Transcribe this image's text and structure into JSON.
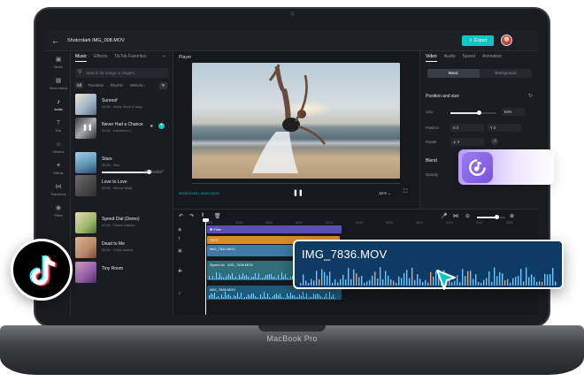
{
  "topbar": {
    "project_name": "Shotcrdark  IMG_008.MOV",
    "export_label": "Export"
  },
  "rail": {
    "items": [
      {
        "label": "Media",
        "icon": "media-icon"
      },
      {
        "label": "Stock videos",
        "icon": "stock-icon"
      },
      {
        "label": "Audio",
        "icon": "audio-icon",
        "active": true
      },
      {
        "label": "Text",
        "icon": "text-icon"
      },
      {
        "label": "Stickers",
        "icon": "stickers-icon"
      },
      {
        "label": "Effects",
        "icon": "effects-icon"
      },
      {
        "label": "Transitions",
        "icon": "transitions-icon"
      },
      {
        "label": "Filters",
        "icon": "filters-icon"
      }
    ]
  },
  "music": {
    "tabs": [
      "Music",
      "Effects",
      "TikTok Favorites"
    ],
    "search_placeholder": "Search for songs or singers",
    "filters": [
      "All",
      "Favorites",
      "Rhythm",
      "Melodic ‹"
    ],
    "tracks": [
      {
        "title": "Sunroof",
        "sub": "02:46 · Nicky Youre & dazy"
      },
      {
        "title": "Never Had a Chance",
        "sub": "01:45 · Katherine Li"
      },
      {
        "title": "Stars",
        "sub": "00:28 · Nico"
      },
      {
        "title": "Love to Love",
        "sub": "00:35 · Widow Waltz"
      },
      {
        "title": "Speed Dial (Demo)",
        "sub": "02:18 · Tanner Adams"
      },
      {
        "title": "Dead to Me",
        "sub": "02:24 · Chloe Adams"
      },
      {
        "title": "Tiny Room",
        "sub": ""
      }
    ],
    "progress_time": "00:38 / 02:27",
    "progress": 0.78
  },
  "player": {
    "label": "Player",
    "time": "00:00:00:15 / 00:00:23:00",
    "ratio": "16:9 ⌄"
  },
  "inspector": {
    "tabs": [
      "Video",
      "Audio",
      "Speed",
      "Animation"
    ],
    "segments": [
      "Basic",
      "Background"
    ],
    "position_title": "Position and size",
    "size_label": "Size",
    "size_value": "63%",
    "size_fraction": 0.63,
    "position_label": "Position",
    "pos_x": "X  2",
    "pos_y": "Y  2",
    "rotate_label": "Rotate",
    "rotate_value": "∠  2",
    "blend_title": "Blend",
    "opacity_label": "Opacity"
  },
  "timeline": {
    "ruler": [
      "00:00",
      "00:03",
      "00:06",
      "00:09",
      "00:12",
      "00:15",
      "00:18",
      "00:21",
      "00:24",
      "00:27",
      "00:30"
    ],
    "clips": {
      "filter": "✱ Filter",
      "text": "TEXT",
      "video1": "IMG_7842.MOV",
      "video2_a": "Speed 4x",
      "video2_b": "IMG_7836.MOV",
      "audio": "IMG_7836.MOV"
    },
    "zoom": 0.7
  },
  "overlay": {
    "wave_title": "IMG_7836.MOV"
  },
  "laptop": {
    "brand": "MacBook Pro"
  },
  "colors": {
    "accent": "#0fc6c2",
    "panel": "#1a1c21",
    "wave": "#0e3a66"
  }
}
